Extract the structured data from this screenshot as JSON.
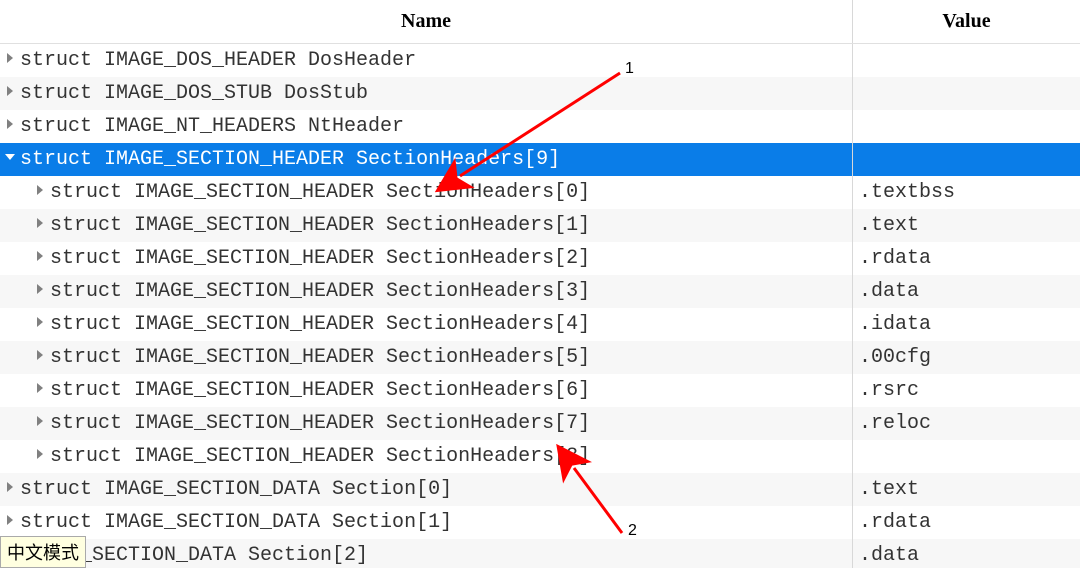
{
  "header": {
    "name_label": "Name",
    "value_label": "Value"
  },
  "rows": [
    {
      "indent": 0,
      "expand": "collapsed",
      "name": "struct IMAGE_DOS_HEADER DosHeader",
      "value": "",
      "selected": false
    },
    {
      "indent": 0,
      "expand": "collapsed",
      "name": "struct IMAGE_DOS_STUB DosStub",
      "value": "",
      "selected": false
    },
    {
      "indent": 0,
      "expand": "collapsed",
      "name": "struct IMAGE_NT_HEADERS NtHeader",
      "value": "",
      "selected": false
    },
    {
      "indent": 0,
      "expand": "expanded",
      "name": "struct IMAGE_SECTION_HEADER SectionHeaders[9]",
      "value": "",
      "selected": true
    },
    {
      "indent": 1,
      "expand": "collapsed",
      "name": "struct IMAGE_SECTION_HEADER SectionHeaders[0]",
      "value": ".textbss",
      "selected": false
    },
    {
      "indent": 1,
      "expand": "collapsed",
      "name": "struct IMAGE_SECTION_HEADER SectionHeaders[1]",
      "value": ".text",
      "selected": false
    },
    {
      "indent": 1,
      "expand": "collapsed",
      "name": "struct IMAGE_SECTION_HEADER SectionHeaders[2]",
      "value": ".rdata",
      "selected": false
    },
    {
      "indent": 1,
      "expand": "collapsed",
      "name": "struct IMAGE_SECTION_HEADER SectionHeaders[3]",
      "value": ".data",
      "selected": false
    },
    {
      "indent": 1,
      "expand": "collapsed",
      "name": "struct IMAGE_SECTION_HEADER SectionHeaders[4]",
      "value": ".idata",
      "selected": false
    },
    {
      "indent": 1,
      "expand": "collapsed",
      "name": "struct IMAGE_SECTION_HEADER SectionHeaders[5]",
      "value": ".00cfg",
      "selected": false
    },
    {
      "indent": 1,
      "expand": "collapsed",
      "name": "struct IMAGE_SECTION_HEADER SectionHeaders[6]",
      "value": ".rsrc",
      "selected": false
    },
    {
      "indent": 1,
      "expand": "collapsed",
      "name": "struct IMAGE_SECTION_HEADER SectionHeaders[7]",
      "value": ".reloc",
      "selected": false
    },
    {
      "indent": 1,
      "expand": "collapsed",
      "name": "struct IMAGE_SECTION_HEADER SectionHeaders[8]",
      "value": "",
      "selected": false
    },
    {
      "indent": 0,
      "expand": "collapsed",
      "name": "struct IMAGE_SECTION_DATA Section[0]",
      "value": ".text",
      "selected": false
    },
    {
      "indent": 0,
      "expand": "collapsed",
      "name": "struct IMAGE_SECTION_DATA Section[1]",
      "value": ".rdata",
      "selected": false
    },
    {
      "indent": 0,
      "expand": "none",
      "name": "IMAGE_SECTION_DATA Section[2]",
      "value": ".data",
      "selected": false,
      "prefixCovered": true
    }
  ],
  "tooltip": {
    "text": "中文模式"
  },
  "annotations": {
    "label1": "1",
    "label2": "2"
  }
}
